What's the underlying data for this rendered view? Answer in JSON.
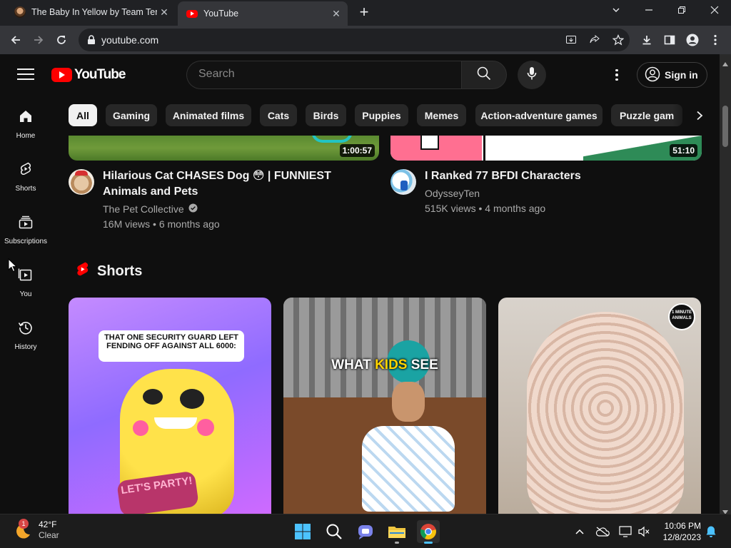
{
  "browser": {
    "tabs": [
      {
        "title": "The Baby In Yellow by Team Terri",
        "active": false
      },
      {
        "title": "YouTube",
        "active": true
      }
    ],
    "url": "youtube.com",
    "new_tab_label": "+"
  },
  "youtube": {
    "logo_text": "YouTube",
    "search_placeholder": "Search",
    "signin_label": "Sign in",
    "sidebar": [
      {
        "label": "Home",
        "icon": "home-icon"
      },
      {
        "label": "Shorts",
        "icon": "shorts-icon"
      },
      {
        "label": "Subscriptions",
        "icon": "subscriptions-icon"
      },
      {
        "label": "You",
        "icon": "you-icon"
      },
      {
        "label": "History",
        "icon": "history-icon"
      }
    ],
    "chips": [
      "All",
      "Gaming",
      "Animated films",
      "Cats",
      "Birds",
      "Puppies",
      "Memes",
      "Action-adventure games",
      "Puzzle gam"
    ],
    "videos": [
      {
        "title": "Hilarious Cat CHASES Dog 😳 | FUNNIEST Animals and Pets",
        "channel": "The Pet Collective",
        "verified": true,
        "views": "16M views",
        "age": "6 months ago",
        "duration": "1:00:57"
      },
      {
        "title": "I Ranked 77 BFDI Characters",
        "channel": "OdysseyTen",
        "verified": false,
        "views": "515K views",
        "age": "4 months ago",
        "duration": "51:10"
      }
    ],
    "meta_separator": " • ",
    "shorts_heading": "Shorts",
    "shorts": [
      {
        "overlay_text": "THAT ONE SECURITY GUARD LEFT FENDING OFF AGAINST ALL 6000:",
        "sign_text": "LET'S PARTY!"
      },
      {
        "overlay_text_a": "WHAT ",
        "overlay_text_b": "KIDS",
        "overlay_text_c": " SEE"
      },
      {
        "overlay_text": "",
        "badge": "1 MINUTE ANIMALS"
      }
    ]
  },
  "taskbar": {
    "weather_temp": "42°F",
    "weather_desc": "Clear",
    "weather_badge": "1",
    "time": "10:06 PM",
    "date": "12/8/2023"
  },
  "colors": {
    "yt_bg": "#0f0f0f",
    "yt_red": "#ff0000",
    "chip_bg": "#272727",
    "chip_active_bg": "#f1f1f1",
    "meta_text": "#aaaaaa"
  }
}
